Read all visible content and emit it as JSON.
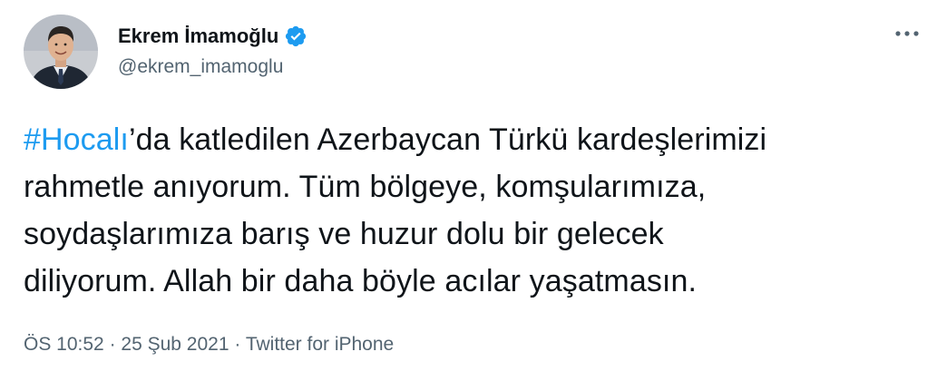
{
  "author": {
    "display_name": "Ekrem İmamoğlu",
    "handle": "@ekrem_imamoglu",
    "verified": true,
    "avatar_icon": "profile-photo"
  },
  "tweet": {
    "hashtag": "#Hocalı",
    "line1_rest": "’da katledilen Azerbaycan Türkü kardeşlerimizi",
    "line2": "rahmetle anıyorum. Tüm bölgeye, komşularımıza,",
    "line3": "soydaşlarımıza barış ve huzur dolu bir gelecek",
    "line4": "diliyorum. Allah bir daha böyle acılar yaşatmasın."
  },
  "meta": {
    "time": "ÖS 10:52",
    "separator": " · ",
    "date": "25 Şub 2021",
    "source": "Twitter for iPhone"
  },
  "colors": {
    "accent": "#1d9bf0",
    "secondary_text": "#536471",
    "primary_text": "#0f1419"
  },
  "icons": {
    "verified": "verified-badge-icon",
    "more": "more-options-icon"
  }
}
